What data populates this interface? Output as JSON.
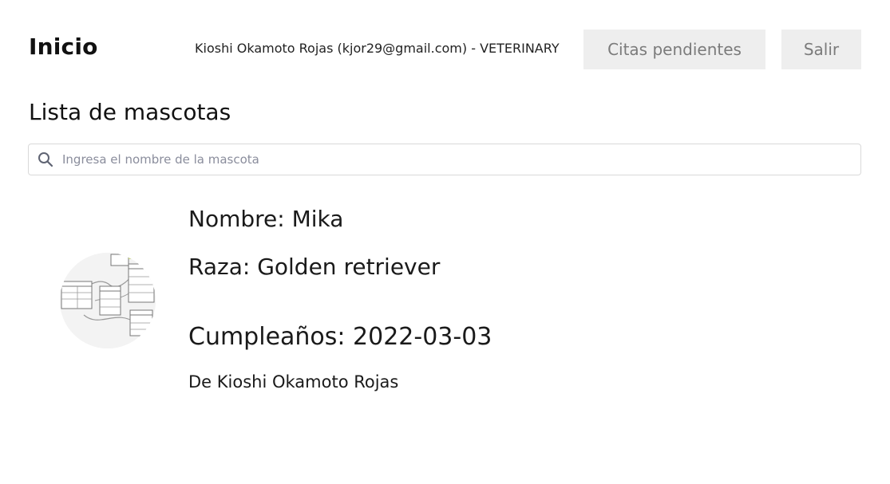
{
  "header": {
    "brand": "Inicio",
    "user_info": "Kioshi Okamoto Rojas (kjor29@gmail.com) - VETERINARY",
    "appointments_button": "Citas pendientes",
    "logout_button": "Salir"
  },
  "main": {
    "title": "Lista de mascotas",
    "search": {
      "placeholder": "Ingresa el nombre de la mascota",
      "value": "",
      "icon": "search-icon"
    },
    "pets": [
      {
        "name_line": "Nombre: Mika",
        "breed_line": "Raza: Golden retriever",
        "birthday_line": "Cumpleaños: 2022-03-03",
        "owner_line": "De Kioshi Okamoto Rojas"
      }
    ]
  },
  "colors": {
    "button_bg": "#eeeeee",
    "button_text": "#7b7b7b",
    "search_border": "#d9d9d9",
    "placeholder": "#8a8d9c"
  }
}
